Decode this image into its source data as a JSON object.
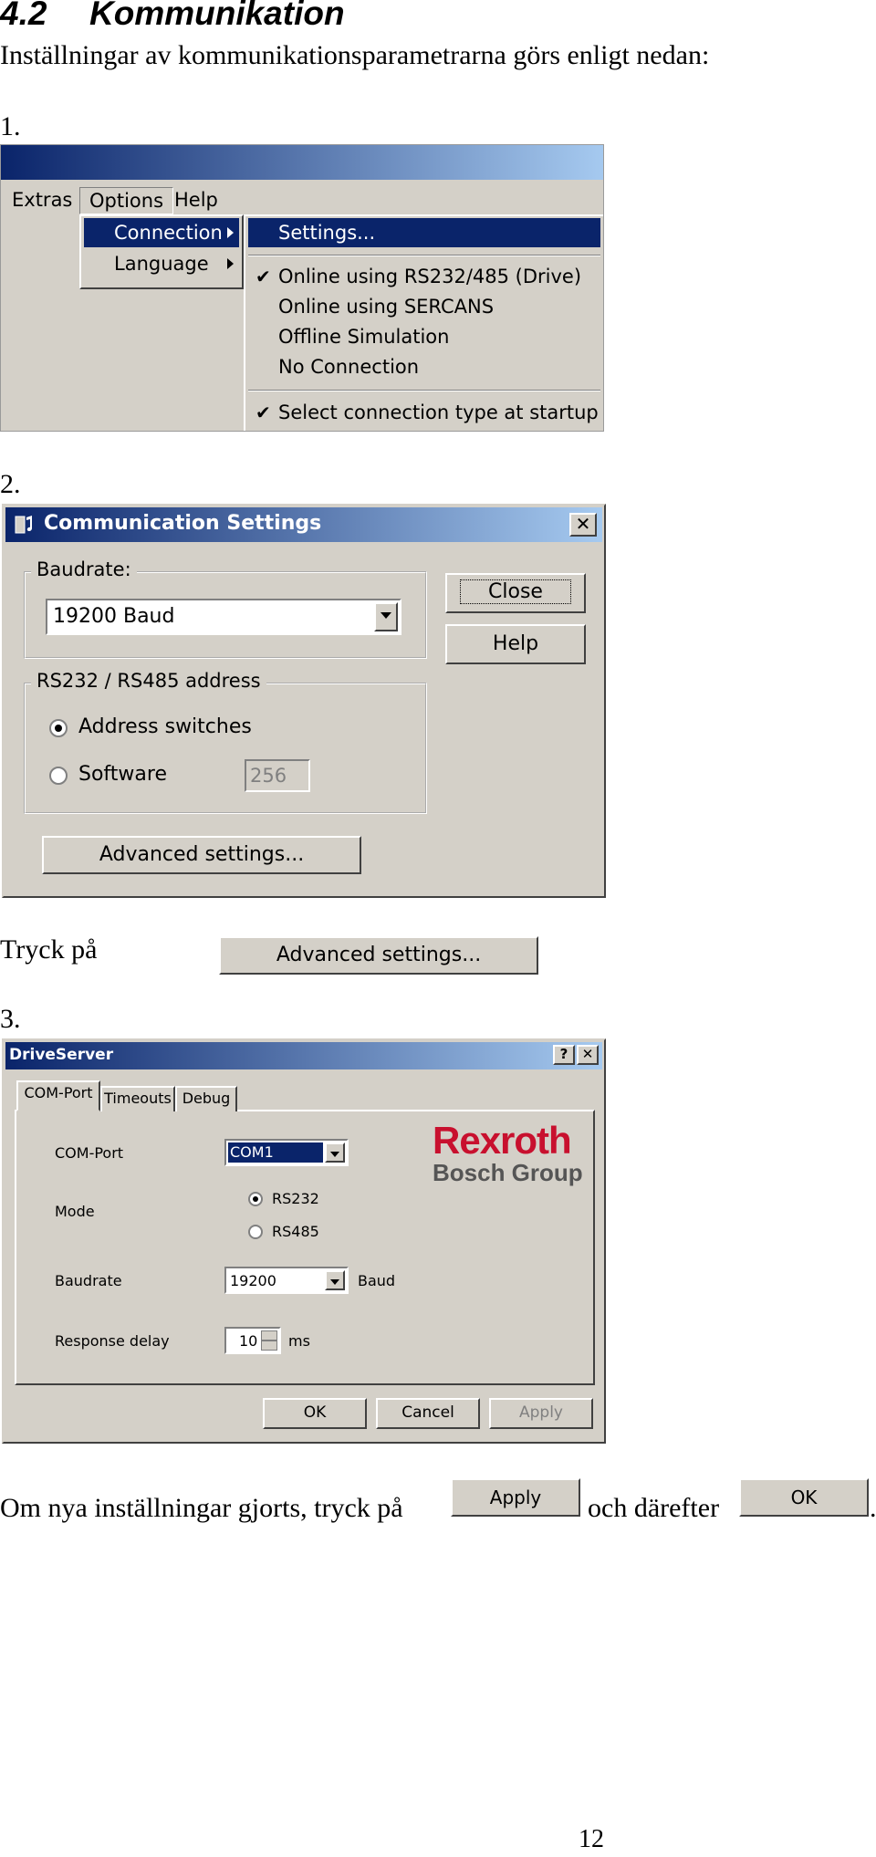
{
  "section": {
    "number": "4.2",
    "title": "Kommunikation"
  },
  "intro": "Inställningar av kommunikationsparametrarna görs enligt nedan:",
  "step_labels": [
    "1.",
    "2.",
    "3."
  ],
  "menu_screenshot": {
    "menubar": [
      "Extras",
      "Options",
      "Help"
    ],
    "options_menu": [
      "Connection",
      "Language"
    ],
    "connection_menu": {
      "settings": "Settings...",
      "online_rs232": "Online using RS232/485 (Drive)",
      "online_sercans": "Online using SERCANS",
      "offline": "Offline Simulation",
      "no_connection": "No Connection",
      "startup": "Select connection type at startup"
    },
    "check_glyph": "✔"
  },
  "comm_dialog": {
    "title": "Communication Settings",
    "close_glyph": "✕",
    "baudrate_label": "Baudrate:",
    "baudrate_value": "19200 Baud",
    "close_button": "Close",
    "help_button": "Help",
    "address_group": "RS232 / RS485 address",
    "radio_switches": "Address switches",
    "radio_software": "Software",
    "software_value": "256",
    "advanced_button": "Advanced settings..."
  },
  "press_text": "Tryck på",
  "press_button": "Advanced settings...",
  "driveserver": {
    "title": "DriveServer",
    "help_glyph": "?",
    "close_glyph": "✕",
    "tabs": [
      "COM-Port",
      "Timeouts",
      "Debug"
    ],
    "comport_label": "COM-Port",
    "comport_value": "COM1",
    "mode_label": "Mode",
    "mode_rs232": "RS232",
    "mode_rs485": "RS485",
    "baudrate_label": "Baudrate",
    "baudrate_value": "19200",
    "baud_unit": "Baud",
    "delay_label": "Response delay",
    "delay_value": "10",
    "delay_unit": "ms",
    "logo_line1": "Rexroth",
    "logo_line2": "Bosch Group",
    "ok": "OK",
    "cancel": "Cancel",
    "apply": "Apply"
  },
  "final_text": {
    "part1": "Om nya inställningar gjorts, tryck på",
    "apply_button": "Apply",
    "part2": "och därefter",
    "ok_button": "OK",
    "end": "."
  },
  "page_number": "12"
}
